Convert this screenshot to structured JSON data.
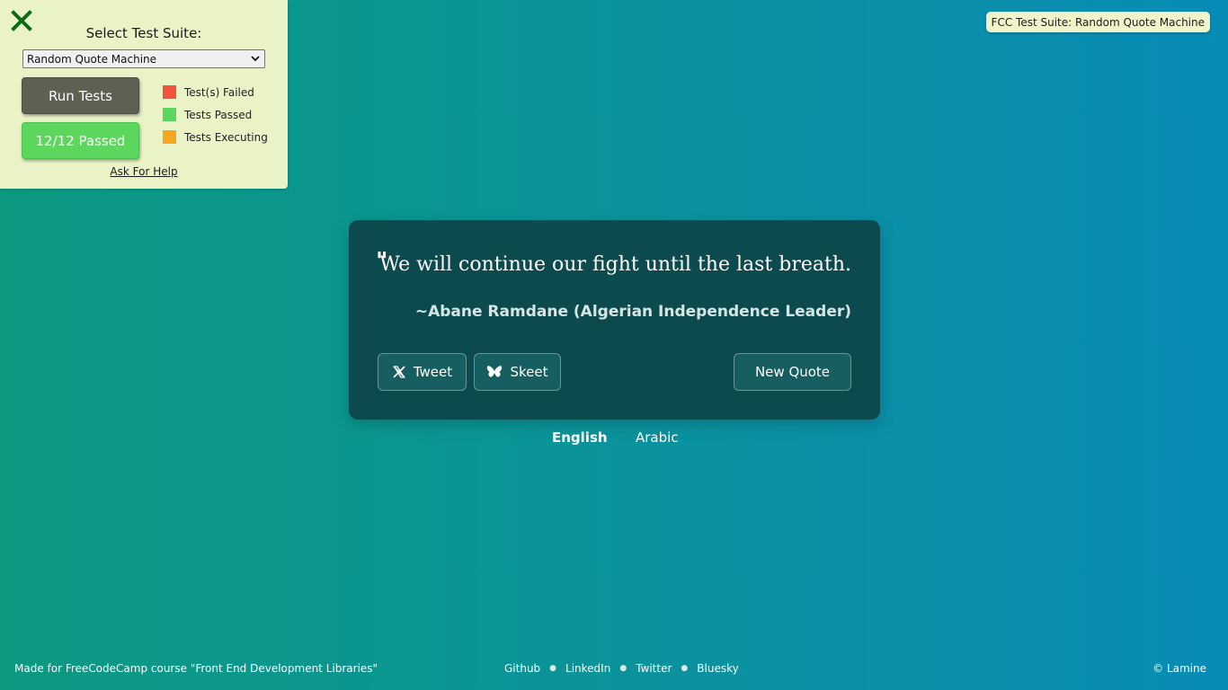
{
  "fcc_panel": {
    "title": "Select Test Suite:",
    "select_value": "Random Quote Machine",
    "run_button": "Run Tests",
    "result_button": "12/12 Passed",
    "legend": [
      {
        "label": "Test(s) Failed",
        "color": "#f0533e"
      },
      {
        "label": "Tests Passed",
        "color": "#5cd65c"
      },
      {
        "label": "Tests Executing",
        "color": "#f5a623"
      }
    ],
    "help_link": "Ask For Help"
  },
  "fcc_badge": "FCC Test Suite: Random Quote Machine",
  "quote": {
    "mark": "\"",
    "text": "We will continue our fight until the last breath.",
    "author": "~Abane Ramdane (Algerian Independence Leader)"
  },
  "buttons": {
    "tweet": "Tweet",
    "skeet": "Skeet",
    "new_quote": "New Quote"
  },
  "languages": {
    "english": "English",
    "arabic": "Arabic"
  },
  "footer": {
    "left": "Made for FreeCodeCamp course \"Front End Development Libraries\"",
    "links": [
      "Github",
      "LinkedIn",
      "Twitter",
      "Bluesky"
    ],
    "right": "© Lamine"
  },
  "colors": {
    "quote_box": "#0c4a4e",
    "panel_bg": "#e9f3c6",
    "passed": "#5cd65c"
  }
}
